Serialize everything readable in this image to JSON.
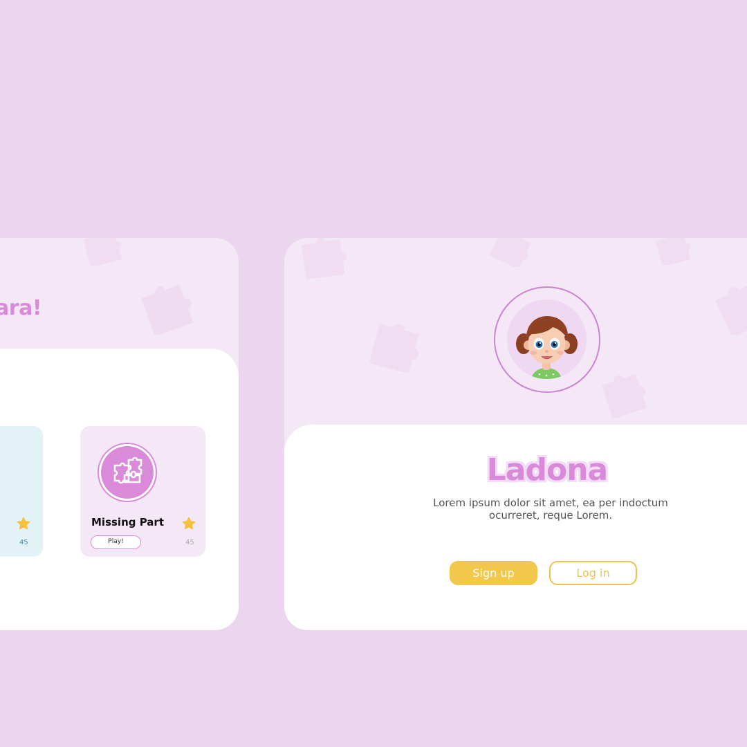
{
  "left_screen": {
    "greeting": "ara!",
    "cards": [
      {
        "id": "blue-card",
        "count": "45",
        "rating_icon": "star-icon"
      },
      {
        "id": "pink-card",
        "title": "Missing Part",
        "play_label": "Play!",
        "count": "45",
        "icon": "puzzle-icon",
        "rating_icon": "star-icon"
      }
    ]
  },
  "right_screen": {
    "avatar": "girl-avatar",
    "brand": "Ladona",
    "description": "Lorem ipsum dolor sit amet, ea per indoctum ocurreret, reque Lorem.",
    "signup_label": "Sign up",
    "login_label": "Log in"
  },
  "colors": {
    "background": "#ecd5ef",
    "screen_bg": "#f4e7f6",
    "accent_pink": "#d98ad8",
    "accent_yellow": "#f1c84b",
    "card_blue": "#e2f2f7"
  }
}
